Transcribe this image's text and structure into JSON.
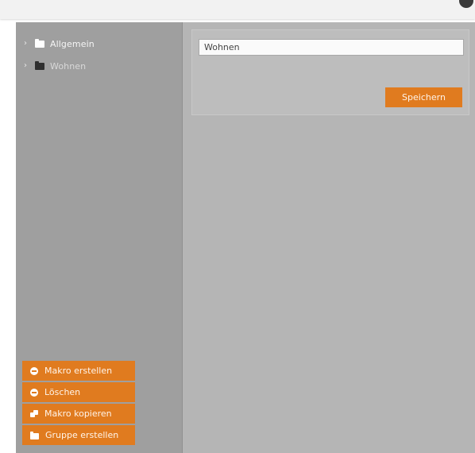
{
  "tree": {
    "items": [
      {
        "label": "Allgemein",
        "icon": "folder-icon"
      },
      {
        "label": "Wohnen",
        "icon": "folder-icon"
      }
    ]
  },
  "editor": {
    "name_value": "Wohnen",
    "save_label": "Speichern"
  },
  "actions": {
    "create_macro": "Makro erstellen",
    "delete": "Löschen",
    "copy_macro": "Makro kopieren",
    "create_group": "Gruppe erstellen"
  },
  "colors": {
    "accent": "#e07b1f",
    "sidebar": "#9f9f9f",
    "main": "#b5b5b5"
  }
}
